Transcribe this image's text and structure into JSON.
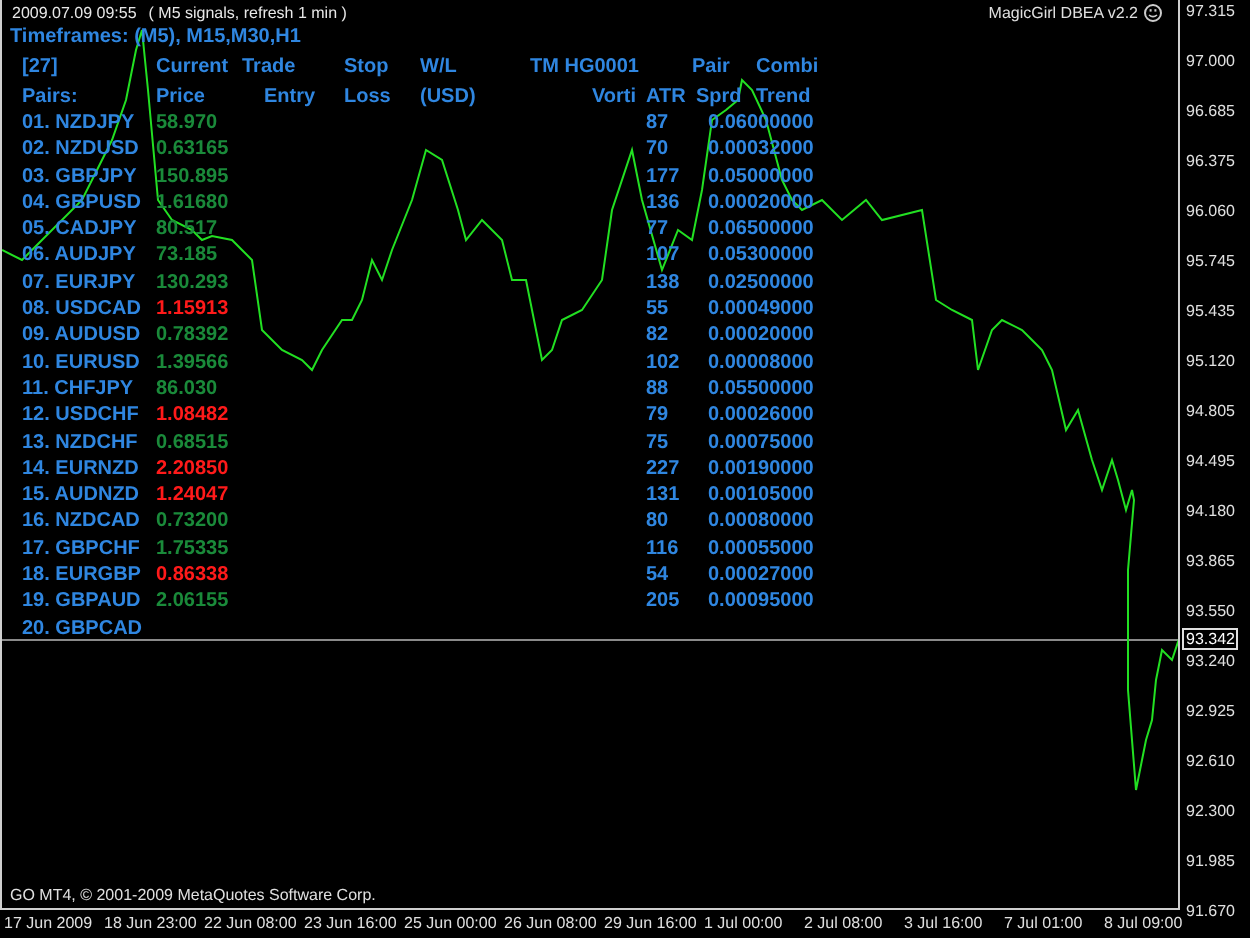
{
  "header": {
    "timestamp": "2009.07.09 09:55",
    "status": "( M5 signals, refresh 1 min )",
    "timeframes": "Timeframes: (M5), M15,M30,H1",
    "badge": "MagicGirl DBEA v2.2"
  },
  "table": {
    "header_top": [
      "[27]",
      "Current",
      "Trade",
      "Stop",
      "W/L",
      "TM HG0001",
      "Pair",
      "Combi"
    ],
    "header_bottom": [
      "Pairs:",
      "Price",
      "Entry",
      "Loss",
      "(USD)",
      "Vorti",
      "ATR",
      "Sprd",
      "Trend"
    ],
    "rows": [
      {
        "pair": "01. NZDJPY",
        "price": "58.970",
        "color": "#1a8a3a",
        "atr": "87",
        "spread": "0.06000000"
      },
      {
        "pair": "02. NZDUSD",
        "price": "0.63165",
        "color": "#1a8a3a",
        "atr": "70",
        "spread": "0.00032000"
      },
      {
        "pair": "03. GBPJPY",
        "price": "150.895",
        "color": "#1a8a3a",
        "atr": "177",
        "spread": "0.05000000"
      },
      {
        "pair": "04. GBPUSD",
        "price": "1.61680",
        "color": "#1a8a3a",
        "atr": "136",
        "spread": "0.00020000"
      },
      {
        "pair": "05. CADJPY",
        "price": "80.517",
        "color": "#1a8a3a",
        "atr": "77",
        "spread": "0.06500000"
      },
      {
        "pair": "06. AUDJPY",
        "price": "73.185",
        "color": "#1a8a3a",
        "atr": "107",
        "spread": "0.05300000"
      },
      {
        "pair": "07. EURJPY",
        "price": "130.293",
        "color": "#1a8a3a",
        "atr": "138",
        "spread": "0.02500000"
      },
      {
        "pair": "08. USDCAD",
        "price": "1.15913",
        "color": "#ff1a1a",
        "atr": "55",
        "spread": "0.00049000"
      },
      {
        "pair": "09. AUDUSD",
        "price": "0.78392",
        "color": "#1a8a3a",
        "atr": "82",
        "spread": "0.00020000"
      },
      {
        "pair": "10. EURUSD",
        "price": "1.39566",
        "color": "#1a8a3a",
        "atr": "102",
        "spread": "0.00008000"
      },
      {
        "pair": "11. CHFJPY",
        "price": "86.030",
        "color": "#1a8a3a",
        "atr": "88",
        "spread": "0.05500000"
      },
      {
        "pair": "12. USDCHF",
        "price": "1.08482",
        "color": "#ff1a1a",
        "atr": "79",
        "spread": "0.00026000"
      },
      {
        "pair": "13. NZDCHF",
        "price": "0.68515",
        "color": "#1a8a3a",
        "atr": "75",
        "spread": "0.00075000"
      },
      {
        "pair": "14. EURNZD",
        "price": "2.20850",
        "color": "#ff1a1a",
        "atr": "227",
        "spread": "0.00190000"
      },
      {
        "pair": "15. AUDNZD",
        "price": "1.24047",
        "color": "#ff1a1a",
        "atr": "131",
        "spread": "0.00105000"
      },
      {
        "pair": "16. NZDCAD",
        "price": "0.73200",
        "color": "#1a8a3a",
        "atr": "80",
        "spread": "0.00080000"
      },
      {
        "pair": "17. GBPCHF",
        "price": "1.75335",
        "color": "#1a8a3a",
        "atr": "116",
        "spread": "0.00055000"
      },
      {
        "pair": "18. EURGBP",
        "price": "0.86338",
        "color": "#ff1a1a",
        "atr": "54",
        "spread": "0.00027000"
      },
      {
        "pair": "19. GBPAUD",
        "price": "2.06155",
        "color": "#1a8a3a",
        "atr": "205",
        "spread": "0.00095000"
      },
      {
        "pair": "20. GBPCAD"
      }
    ]
  },
  "price_axis": [
    "97.315",
    "97.000",
    "96.685",
    "96.375",
    "96.060",
    "95.745",
    "95.435",
    "95.120",
    "94.805",
    "94.495",
    "94.180",
    "93.865",
    "93.550",
    "93.240",
    "92.925",
    "92.610",
    "92.300",
    "91.985",
    "91.670"
  ],
  "current_price": "93.342",
  "time_axis": [
    "17 Jun 2009",
    "18 Jun 23:00",
    "22 Jun 08:00",
    "23 Jun 16:00",
    "25 Jun 00:00",
    "26 Jun 08:00",
    "29 Jun 16:00",
    "1 Jul 00:00",
    "2 Jul 08:00",
    "3 Jul 16:00",
    "7 Jul 01:00",
    "8 Jul 09:00"
  ],
  "copyright": "GO MT4, © 2001-2009 MetaQuotes Software Corp."
}
